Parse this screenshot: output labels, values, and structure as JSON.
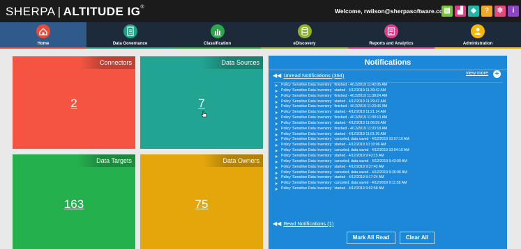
{
  "brand": {
    "name_light": "SHERPA",
    "name_bold": "ALTITUDE IG",
    "mark": "®"
  },
  "header": {
    "welcome": "Welcome, rwilson@sherpasoftware.com"
  },
  "toolbar_icons": [
    {
      "name": "doc-icon",
      "color": "#7cc242",
      "glyph": "▤"
    },
    {
      "name": "chart-icon",
      "color": "#e23b8b",
      "glyph": "▟"
    },
    {
      "name": "shield-icon",
      "color": "#1fb6a8",
      "glyph": "◆"
    },
    {
      "name": "help-icon",
      "color": "#f5a623",
      "glyph": "?"
    },
    {
      "name": "gear-icon",
      "color": "#e7497c",
      "glyph": "✲"
    },
    {
      "name": "info-icon",
      "color": "#8e44c8",
      "glyph": "i"
    }
  ],
  "nav": [
    {
      "label": "Home",
      "color": "#e84a3c",
      "icon": "home-icon"
    },
    {
      "label": "Data Governance",
      "color": "#19a487",
      "icon": "document-icon"
    },
    {
      "label": "Classification",
      "color": "#29a84a",
      "icon": "bar-chart-icon"
    },
    {
      "label": "eDiscovery",
      "color": "#8fb22a",
      "icon": "database-icon"
    },
    {
      "label": "Reports and Analytics",
      "color": "#e23b8b",
      "icon": "report-icon"
    },
    {
      "label": "Administration",
      "color": "#f5b700",
      "icon": "user-icon"
    }
  ],
  "tiles": [
    {
      "label": "Connectors",
      "value": "2",
      "color": "#f45441"
    },
    {
      "label": "Data Sources",
      "value": "7",
      "color": "#21a592"
    },
    {
      "label": "Data Targets",
      "value": "163",
      "color": "#25b04e"
    },
    {
      "label": "Data Owners",
      "value": "75",
      "color": "#e5a60c"
    }
  ],
  "notifications": {
    "title": "Notifications",
    "unread_link": "Unread Notifications (364)",
    "view_more": "view more",
    "items": [
      "Policy 'Sensitive Data Inventory ' finished - 4/12/2019 11:42:05 AM",
      "Policy 'Sensitive Data Inventory ' started - 4/12/2019 11:39:42 AM",
      "Policy 'Sensitive Data Inventory ' finished - 4/12/2019 11:38:24 AM",
      "Policy 'Sensitive Data Inventory ' started - 4/12/2019 11:29:47 AM",
      "Policy 'Sensitive Data Inventory ' finished - 4/12/2019 11:23:06 AM",
      "Policy 'Sensitive Data Inventory ' started - 4/12/2019 11:21:14 AM",
      "Policy 'Sensitive Data Inventory ' finished - 4/12/2019 11:09:10 AM",
      "Policy 'Sensitive Data Inventory ' started - 4/12/2019 11:06:59 AM",
      "Policy 'Sensitive Data Inventory ' finished - 4/12/2019 11:03:18 AM",
      "Policy 'Sensitive Data Inventory ' started - 4/12/2019 11:01:26 AM",
      "Policy 'Sensitive Data Inventory ' canceled, data saved - 4/12/2019 10:57:10 AM",
      "Policy 'Sensitive Data Inventory ' started - 4/12/2019 10:10:06 AM",
      "Policy 'Sensitive Data Inventory ' canceled, data saved - 4/12/2019 10:04:10 AM",
      "Policy 'Sensitive Data Inventory ' started - 4/12/2019 9:43:15 AM",
      "Policy 'Sensitive Data Inventory ' canceled, data saved - 4/12/2019 9:43:09 AM",
      "Policy 'Sensitive Data Inventory ' started - 4/12/2019 9:37:42 AM",
      "Policy 'Sensitive Data Inventory ' canceled, data saved - 4/12/2019 9:36:06 AM",
      "Policy 'Sensitive Data Inventory ' started - 4/12/2019 9:17:24 AM",
      "Policy 'Sensitive Data Inventory ' canceled, data saved - 4/12/2019 9:11:58 AM",
      "Policy 'Sensitive Data Inventory ' started - 4/12/2019 9:02:58 AM"
    ],
    "read_link": "Read Notifications (1)",
    "mark_all_read": "Mark All Read",
    "clear_all": "Clear All"
  }
}
